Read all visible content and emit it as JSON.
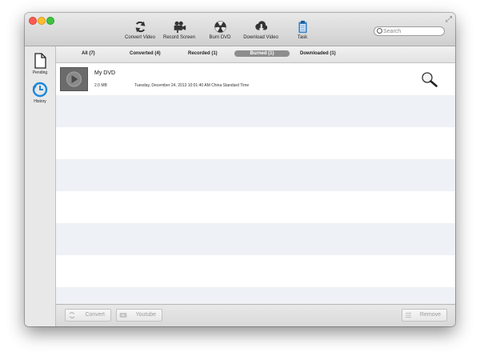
{
  "toolbar": {
    "tools": [
      {
        "label": "Convert Video",
        "icon": "convert-icon"
      },
      {
        "label": "Record Screen",
        "icon": "camera-icon"
      },
      {
        "label": "Burn DVD",
        "icon": "burn-disc-icon"
      },
      {
        "label": "Download Video",
        "icon": "cloud-download-icon"
      },
      {
        "label": "Task",
        "icon": "clipboard-icon"
      }
    ],
    "search_placeholder": "Search"
  },
  "sidebar": {
    "items": [
      {
        "label": "Pending",
        "icon": "document-icon"
      },
      {
        "label": "History",
        "icon": "history-clock-icon"
      }
    ]
  },
  "tabs": [
    {
      "label": "All (7)"
    },
    {
      "label": "Converted (4)"
    },
    {
      "label": "Recorded (1)"
    },
    {
      "label": "Burned (1)",
      "active": true
    },
    {
      "label": "Downloaded (1)"
    }
  ],
  "items": [
    {
      "title": "My DVD",
      "size": "2.0 MB",
      "date": "Tuesday, December 24, 2013 10:01:40 AM China Standard Time"
    }
  ],
  "bottom": {
    "convert_label": "Convert",
    "youtube_label": "Youtube",
    "remove_label": "Remove"
  },
  "colors": {
    "active_tab": "#8d8d8d",
    "row_stripe": "#eef1f5",
    "history_icon": "#1e88d8"
  }
}
